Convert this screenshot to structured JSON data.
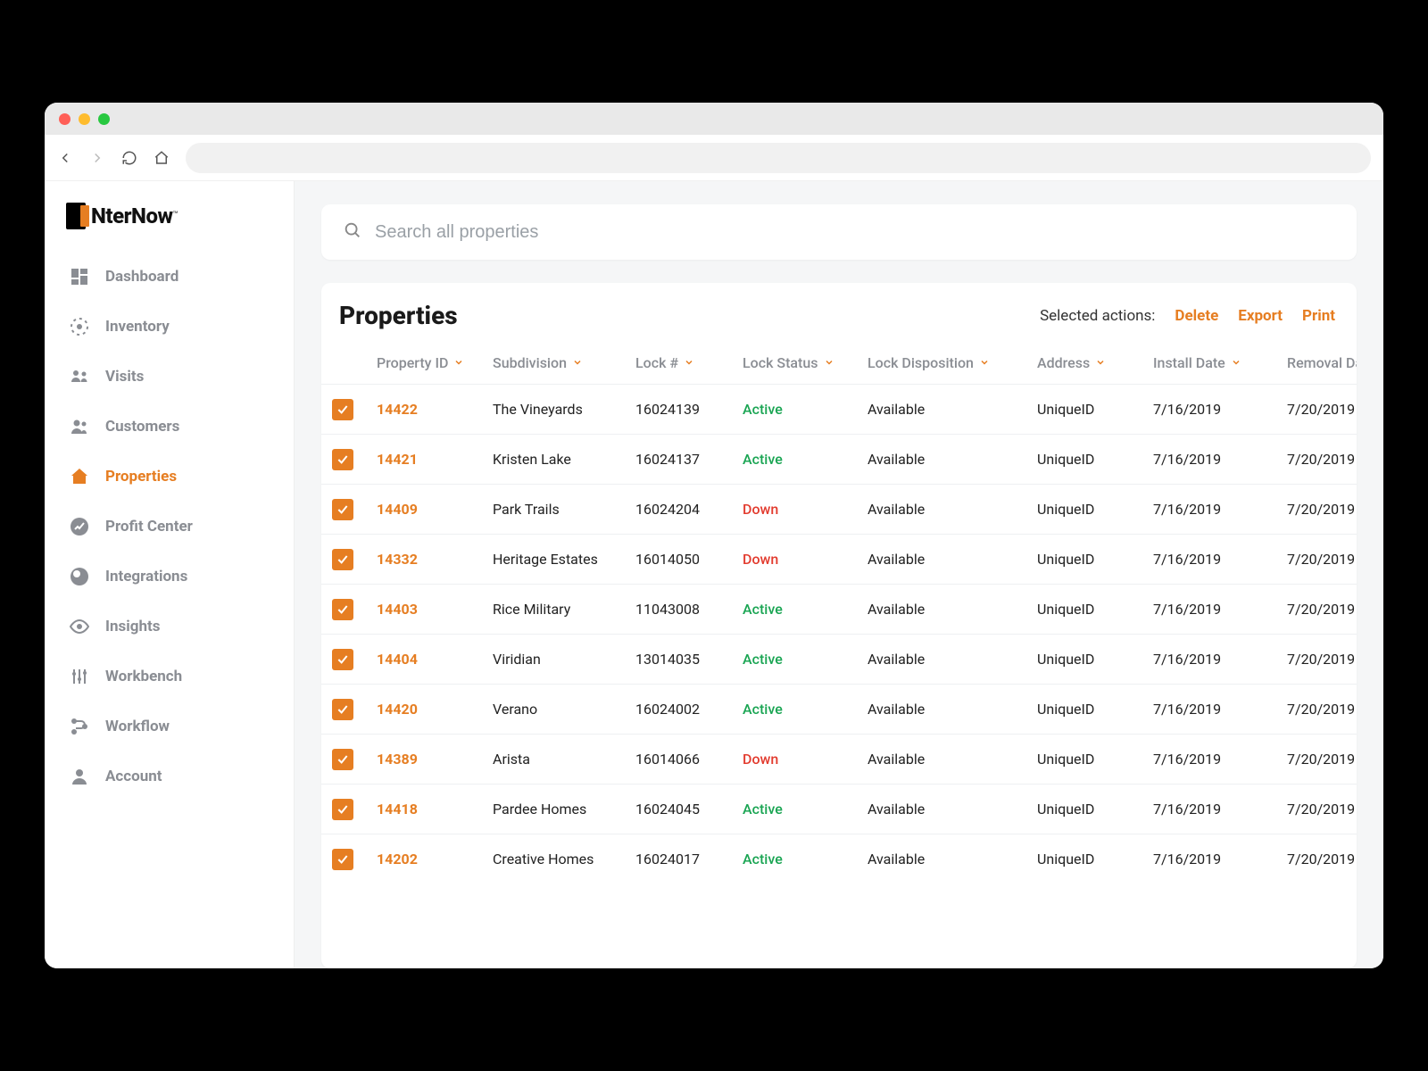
{
  "brand": {
    "name": "NterNow"
  },
  "sidebar": {
    "items": [
      {
        "id": "dashboard",
        "label": "Dashboard"
      },
      {
        "id": "inventory",
        "label": "Inventory"
      },
      {
        "id": "visits",
        "label": "Visits"
      },
      {
        "id": "customers",
        "label": "Customers"
      },
      {
        "id": "properties",
        "label": "Properties",
        "active": true
      },
      {
        "id": "profit-center",
        "label": "Profit Center"
      },
      {
        "id": "integrations",
        "label": "Integrations"
      },
      {
        "id": "insights",
        "label": "Insights"
      },
      {
        "id": "workbench",
        "label": "Workbench"
      },
      {
        "id": "workflow",
        "label": "Workflow"
      },
      {
        "id": "account",
        "label": "Account"
      }
    ]
  },
  "search": {
    "placeholder": "Search all properties"
  },
  "panel": {
    "title": "Properties"
  },
  "actions": {
    "label": "Selected actions:",
    "delete": "Delete",
    "export": "Export",
    "print": "Print"
  },
  "columns": {
    "property_id": "Property ID",
    "subdivision": "Subdivision",
    "lock_no": "Lock #",
    "lock_status": "Lock Status",
    "lock_disposition": "Lock Disposition",
    "address": "Address",
    "install_date": "Install Date",
    "removal_date": "Removal Date"
  },
  "rows": [
    {
      "property_id": "14422",
      "subdivision": "The Vineyards",
      "lock_no": "16024139",
      "lock_status": "Active",
      "lock_disposition": "Available",
      "address": "UniqueID",
      "install_date": "7/16/2019",
      "removal_date": "7/20/2019"
    },
    {
      "property_id": "14421",
      "subdivision": "Kristen Lake",
      "lock_no": "16024137",
      "lock_status": "Active",
      "lock_disposition": "Available",
      "address": "UniqueID",
      "install_date": "7/16/2019",
      "removal_date": "7/20/2019"
    },
    {
      "property_id": "14409",
      "subdivision": "Park Trails",
      "lock_no": "16024204",
      "lock_status": "Down",
      "lock_disposition": "Available",
      "address": "UniqueID",
      "install_date": "7/16/2019",
      "removal_date": "7/20/2019"
    },
    {
      "property_id": "14332",
      "subdivision": "Heritage Estates",
      "lock_no": "16014050",
      "lock_status": "Down",
      "lock_disposition": "Available",
      "address": "UniqueID",
      "install_date": "7/16/2019",
      "removal_date": "7/20/2019"
    },
    {
      "property_id": "14403",
      "subdivision": "Rice Military",
      "lock_no": "11043008",
      "lock_status": "Active",
      "lock_disposition": "Available",
      "address": "UniqueID",
      "install_date": "7/16/2019",
      "removal_date": "7/20/2019"
    },
    {
      "property_id": "14404",
      "subdivision": "Viridian",
      "lock_no": "13014035",
      "lock_status": "Active",
      "lock_disposition": "Available",
      "address": "UniqueID",
      "install_date": "7/16/2019",
      "removal_date": "7/20/2019"
    },
    {
      "property_id": "14420",
      "subdivision": "Verano",
      "lock_no": "16024002",
      "lock_status": "Active",
      "lock_disposition": "Available",
      "address": "UniqueID",
      "install_date": "7/16/2019",
      "removal_date": "7/20/2019"
    },
    {
      "property_id": "14389",
      "subdivision": "Arista",
      "lock_no": "16014066",
      "lock_status": "Down",
      "lock_disposition": "Available",
      "address": "UniqueID",
      "install_date": "7/16/2019",
      "removal_date": "7/20/2019"
    },
    {
      "property_id": "14418",
      "subdivision": "Pardee Homes",
      "lock_no": "16024045",
      "lock_status": "Active",
      "lock_disposition": "Available",
      "address": "UniqueID",
      "install_date": "7/16/2019",
      "removal_date": "7/20/2019"
    },
    {
      "property_id": "14202",
      "subdivision": "Creative Homes",
      "lock_no": "16024017",
      "lock_status": "Active",
      "lock_disposition": "Available",
      "address": "UniqueID",
      "install_date": "7/16/2019",
      "removal_date": "7/20/2019"
    }
  ]
}
